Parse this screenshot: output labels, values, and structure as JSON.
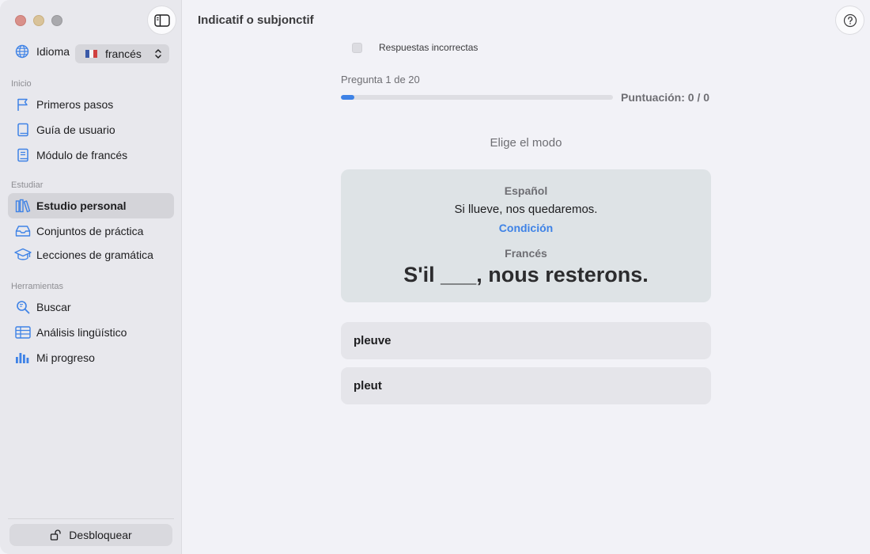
{
  "sidebar": {
    "language_label": "Idioma",
    "language_value": "francés",
    "sections": {
      "inicio": "Inicio",
      "estudiar": "Estudiar",
      "herramientas": "Herramientas"
    },
    "items": [
      {
        "label": "Primeros pasos",
        "icon": "flag-icon"
      },
      {
        "label": "Guía de usuario",
        "icon": "book-icon"
      },
      {
        "label": "Módulo de francés",
        "icon": "module-book-icon"
      },
      {
        "label": "Estudio personal",
        "icon": "library-icon",
        "active": true
      },
      {
        "label": "Conjuntos de práctica",
        "icon": "tray-icon"
      },
      {
        "label": "Lecciones de gramática",
        "icon": "graduation-cap-icon"
      },
      {
        "label": "Buscar",
        "icon": "search-icon"
      },
      {
        "label": "Análisis lingüístico",
        "icon": "table-icon"
      },
      {
        "label": "Mi progreso",
        "icon": "bar-chart-icon"
      }
    ],
    "unlock_label": "Desbloquear"
  },
  "main": {
    "title": "Indicatif o subjonctif",
    "checkbox_label": "Respuestas incorrectas",
    "progress_label": "Pregunta 1 de 20",
    "progress_fraction": 0.05,
    "score": "Puntuación: 0 / 0",
    "mode_label": "Elige el modo",
    "card": {
      "source_language": "Español",
      "source_text": "Si llueve, nos quedaremos.",
      "hint": "Condición",
      "target_language": "Francés",
      "target_text": "S'il ___, nous resterons."
    },
    "options": [
      "pleuve",
      "pleut"
    ]
  },
  "colors": {
    "accent": "#3e82e6",
    "sidebar_bg": "#e8e8ed",
    "card_bg": "#dee3e6"
  }
}
